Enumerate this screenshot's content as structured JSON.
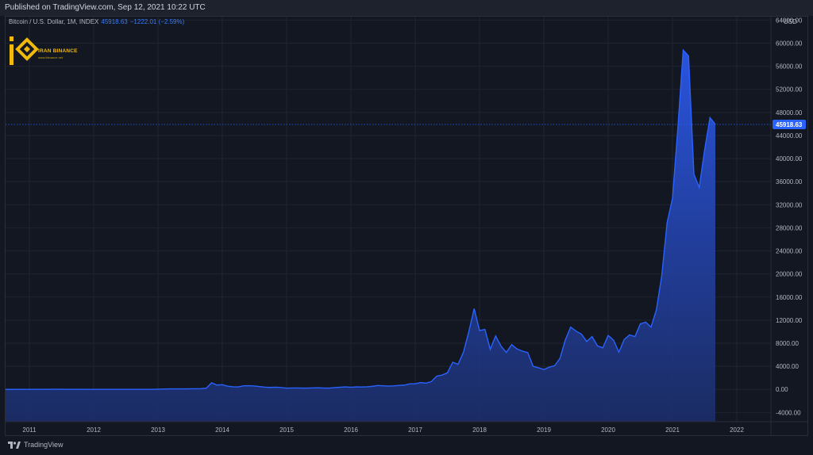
{
  "header": {
    "published": "Published on TradingView.com, Sep 12, 2021 10:22 UTC"
  },
  "legend": {
    "symbol": "Bitcoin / U.S. Dollar, 1M, INDEX",
    "price": "45918.63",
    "change": "−1222.01 (−2.59%)"
  },
  "logo": {
    "text": "IRAN BINANCE",
    "sub": "www.ibinance.net"
  },
  "axis": {
    "currency": "USD",
    "last_price_label": "45918.63"
  },
  "footer": {
    "brand": "TradingView"
  },
  "colors": {
    "background": "#131722",
    "line": "#2962ff",
    "fill_top": "#2b57e8",
    "fill_bottom": "#1c2f6e",
    "last_price": "#2962ff"
  },
  "chart_data": {
    "type": "area",
    "title": "",
    "xlabel": "",
    "ylabel": "",
    "ylim": [
      -5600,
      64600
    ],
    "x_ticks": [
      "2011",
      "2012",
      "2013",
      "2014",
      "2015",
      "2016",
      "2017",
      "2018",
      "2019",
      "2020",
      "2021",
      "2022"
    ],
    "y_ticks": [
      64000,
      60000,
      56000,
      52000,
      48000,
      44000,
      40000,
      36000,
      32000,
      28000,
      24000,
      20000,
      16000,
      12000,
      8000,
      4000,
      0,
      -4000
    ],
    "y_tick_labels": [
      "64000.00",
      "60000.00",
      "56000.00",
      "52000.00",
      "48000.00",
      "44000.00",
      "40000.00",
      "36000.00",
      "32000.00",
      "28000.00",
      "24000.00",
      "20000.00",
      "16000.00",
      "12000.00",
      "8000.00",
      "4000.00",
      "0.00",
      "-4000.00"
    ],
    "last_value": 45918.63,
    "series": [
      {
        "points": [
          [
            "2010-08",
            0.1
          ],
          [
            "2010-12",
            0.3
          ],
          [
            "2011-06",
            17
          ],
          [
            "2011-12",
            5
          ],
          [
            "2012-06",
            7
          ],
          [
            "2012-12",
            13
          ],
          [
            "2013-03",
            94
          ],
          [
            "2013-06",
            97
          ],
          [
            "2013-09",
            128
          ],
          [
            "2013-10",
            204
          ],
          [
            "2013-11",
            1130
          ],
          [
            "2013-12",
            755
          ],
          [
            "2014-01",
            820
          ],
          [
            "2014-02",
            560
          ],
          [
            "2014-03",
            450
          ],
          [
            "2014-04",
            440
          ],
          [
            "2014-05",
            630
          ],
          [
            "2014-06",
            640
          ],
          [
            "2014-07",
            590
          ],
          [
            "2014-08",
            480
          ],
          [
            "2014-09",
            390
          ],
          [
            "2014-10",
            340
          ],
          [
            "2014-11",
            380
          ],
          [
            "2014-12",
            320
          ],
          [
            "2015-01",
            217
          ],
          [
            "2015-02",
            254
          ],
          [
            "2015-03",
            244
          ],
          [
            "2015-04",
            236
          ],
          [
            "2015-05",
            230
          ],
          [
            "2015-06",
            263
          ],
          [
            "2015-07",
            284
          ],
          [
            "2015-08",
            230
          ],
          [
            "2015-09",
            236
          ],
          [
            "2015-10",
            314
          ],
          [
            "2015-11",
            377
          ],
          [
            "2015-12",
            430
          ],
          [
            "2016-01",
            368
          ],
          [
            "2016-02",
            437
          ],
          [
            "2016-03",
            416
          ],
          [
            "2016-04",
            448
          ],
          [
            "2016-05",
            531
          ],
          [
            "2016-06",
            673
          ],
          [
            "2016-07",
            624
          ],
          [
            "2016-08",
            575
          ],
          [
            "2016-09",
            609
          ],
          [
            "2016-10",
            698
          ],
          [
            "2016-11",
            742
          ],
          [
            "2016-12",
            963
          ],
          [
            "2017-01",
            970
          ],
          [
            "2017-02",
            1190
          ],
          [
            "2017-03",
            1079
          ],
          [
            "2017-04",
            1348
          ],
          [
            "2017-05",
            2300
          ],
          [
            "2017-06",
            2480
          ],
          [
            "2017-07",
            2875
          ],
          [
            "2017-08",
            4700
          ],
          [
            "2017-09",
            4340
          ],
          [
            "2017-10",
            6450
          ],
          [
            "2017-11",
            10000
          ],
          [
            "2017-12",
            14000
          ],
          [
            "2018-01",
            10200
          ],
          [
            "2018-02",
            10400
          ],
          [
            "2018-03",
            6950
          ],
          [
            "2018-04",
            9250
          ],
          [
            "2018-05",
            7500
          ],
          [
            "2018-06",
            6400
          ],
          [
            "2018-07",
            7750
          ],
          [
            "2018-08",
            7000
          ],
          [
            "2018-09",
            6630
          ],
          [
            "2018-10",
            6370
          ],
          [
            "2018-11",
            4000
          ],
          [
            "2018-12",
            3750
          ],
          [
            "2019-01",
            3450
          ],
          [
            "2019-02",
            3850
          ],
          [
            "2019-03",
            4100
          ],
          [
            "2019-04",
            5350
          ],
          [
            "2019-05",
            8550
          ],
          [
            "2019-06",
            10800
          ],
          [
            "2019-07",
            10100
          ],
          [
            "2019-08",
            9600
          ],
          [
            "2019-09",
            8300
          ],
          [
            "2019-10",
            9150
          ],
          [
            "2019-11",
            7550
          ],
          [
            "2019-12",
            7200
          ],
          [
            "2020-01",
            9350
          ],
          [
            "2020-02",
            8550
          ],
          [
            "2020-03",
            6450
          ],
          [
            "2020-04",
            8650
          ],
          [
            "2020-05",
            9450
          ],
          [
            "2020-06",
            9150
          ],
          [
            "2020-07",
            11350
          ],
          [
            "2020-08",
            11650
          ],
          [
            "2020-09",
            10800
          ],
          [
            "2020-10",
            13800
          ],
          [
            "2020-11",
            19700
          ],
          [
            "2020-12",
            28900
          ],
          [
            "2021-01",
            33100
          ],
          [
            "2021-02",
            45200
          ],
          [
            "2021-03",
            58800
          ],
          [
            "2021-04",
            57800
          ],
          [
            "2021-05",
            37300
          ],
          [
            "2021-06",
            35000
          ],
          [
            "2021-07",
            41500
          ],
          [
            "2021-08",
            47100
          ],
          [
            "2021-09",
            45918.63
          ]
        ]
      }
    ]
  }
}
